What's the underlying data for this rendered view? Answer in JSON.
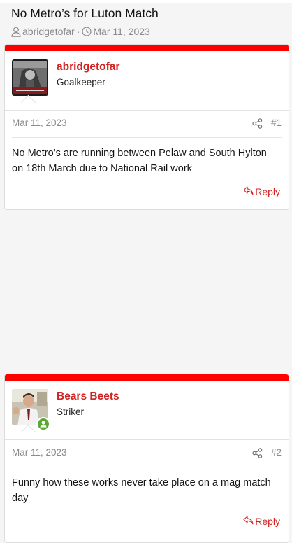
{
  "thread": {
    "title": "No Metro’s for Luton Match",
    "author": "abridgetofar",
    "separator": "·",
    "date": "Mar 11, 2023"
  },
  "posts": [
    {
      "username": "abridgetofar",
      "user_title": "Goalkeeper",
      "date": "Mar 11, 2023",
      "number": "#1",
      "body": "No Metro’s are running between Pelaw and South Hylton on 18th March due to National Rail work",
      "reply_label": "Reply"
    },
    {
      "username": "Bears Beets",
      "user_title": "Striker",
      "date": "Mar 11, 2023",
      "number": "#2",
      "body": "Funny how these works never take place on a mag match day",
      "reply_label": "Reply"
    }
  ],
  "colors": {
    "accent": "#d12323",
    "post_bar": "#ff0000",
    "online": "#5aa832",
    "muted": "#8a8a8a"
  },
  "icons": [
    "user-icon",
    "clock-icon",
    "share-icon",
    "reply-icon",
    "online-status-icon"
  ]
}
